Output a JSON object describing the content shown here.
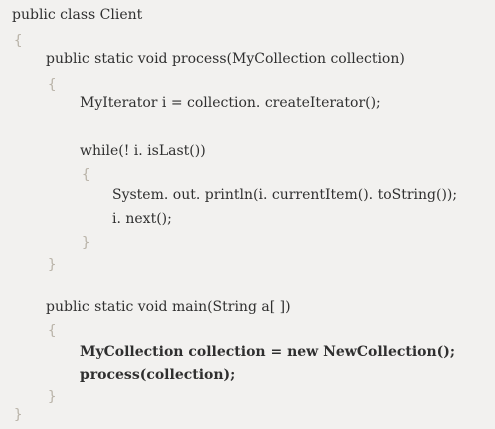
{
  "code": {
    "lines": [
      "public class Client",
      "{",
      "public static void process(MyCollection collection)",
      "{",
      "MyIterator i = collection. createIterator();",
      "while(! i. isLast())",
      "{",
      "System. out. println(i. currentItem(). toString());",
      "i. next();",
      "}",
      "}",
      "public static void main(String a[ ])",
      "{",
      "MyCollection collection = new NewCollection();",
      "process(collection);",
      "}",
      "}"
    ]
  }
}
